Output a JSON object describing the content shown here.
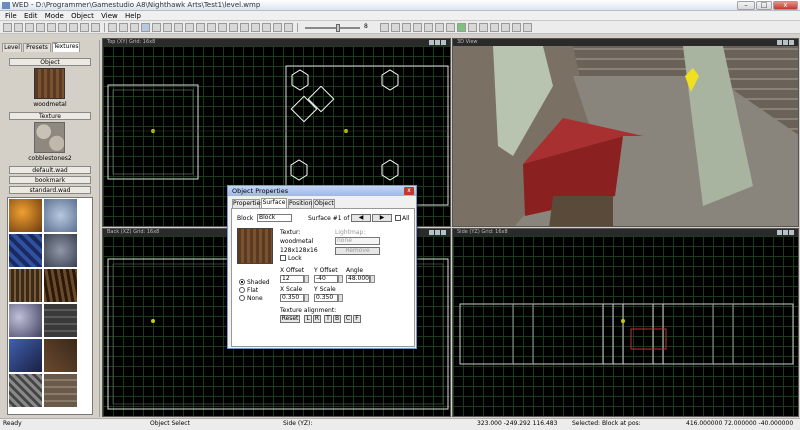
{
  "window": {
    "title": "WED - D:\\Programmer\\Gamestudio A8\\Nighthawk Arts\\Test1\\level.wmp",
    "min": "–",
    "max": "□",
    "close": "x"
  },
  "menu": [
    "File",
    "Edit",
    "Mode",
    "Object",
    "View",
    "Help"
  ],
  "toolbar": {
    "slider_value": "8"
  },
  "left_tabs": [
    "Level",
    "Presets",
    "Textures"
  ],
  "left_panel": {
    "object_label": "Object",
    "object_texture": "woodmetal",
    "texture_label": "Texture",
    "texture_name": "cobblestones2",
    "wads": [
      "default.wad",
      "bookmark",
      "standard.wad"
    ]
  },
  "viewports": {
    "top": "Top (XY) Grid: 16x8",
    "view3d": "3D View",
    "back": "Back (XZ) Grid: 16x8",
    "side": "Side (YZ) Grid: 16x8"
  },
  "dialog": {
    "title": "Object Properties",
    "close": "x",
    "tabs": [
      "Properties",
      "Surface",
      "Position",
      "Object"
    ],
    "block_label": "Block",
    "block_value": "Block",
    "surface_label": "Surface #1 of 6",
    "all_label": "All",
    "texture_label": "Textur:",
    "texture_value": "woodmetal",
    "lightmap_label": "Lightmap:",
    "lightmap_value": "none",
    "size": "128x128x16",
    "lock": "Lock",
    "remove": "Remove",
    "xoffset_label": "X Offset",
    "xoffset": "12",
    "yoffset_label": "Y Offset",
    "yoffset": "-40",
    "angle_label": "Angle",
    "angle": "48.000",
    "xscale_label": "X Scale",
    "xscale": "0.350",
    "yscale_label": "Y Scale",
    "yscale": "0.350",
    "shading": [
      "Shaded",
      "Flat",
      "None"
    ],
    "align_label": "Texture alignment:",
    "align_buttons": [
      "Reset",
      "L",
      "R",
      "T",
      "B",
      "C",
      "F"
    ]
  },
  "status": {
    "left": "Ready",
    "mode": "Object Select",
    "view": "Side (YZ):",
    "coords": "323.000 -249.292 116.483",
    "selected": "Selected: Block at pos:",
    "pos": "416.000000 72.000000 -40.000000"
  }
}
